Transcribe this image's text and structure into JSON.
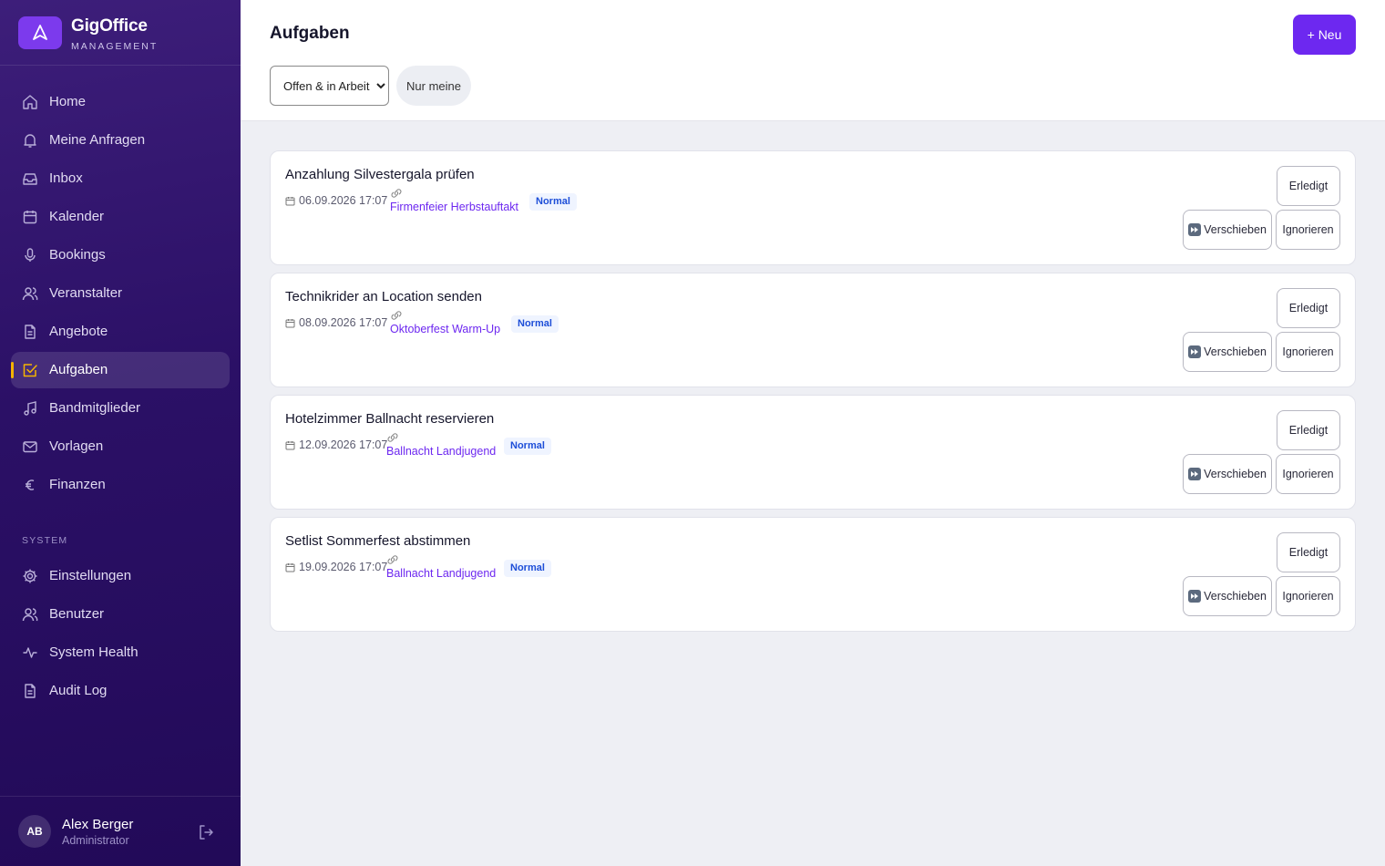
{
  "brand": {
    "name": "GigOffice",
    "subtitle": "MANAGEMENT"
  },
  "sidebar": {
    "items": [
      {
        "label": "Home",
        "icon": "home-icon"
      },
      {
        "label": "Meine Anfragen",
        "icon": "bell-icon"
      },
      {
        "label": "Inbox",
        "icon": "inbox-icon"
      },
      {
        "label": "Kalender",
        "icon": "calendar-icon"
      },
      {
        "label": "Bookings",
        "icon": "microphone-icon"
      },
      {
        "label": "Veranstalter",
        "icon": "users-icon"
      },
      {
        "label": "Angebote",
        "icon": "document-icon"
      },
      {
        "label": "Aufgaben",
        "icon": "checkbox-icon",
        "active": true
      },
      {
        "label": "Bandmitglieder",
        "icon": "music-icon"
      },
      {
        "label": "Vorlagen",
        "icon": "mail-icon"
      },
      {
        "label": "Finanzen",
        "icon": "euro-icon"
      }
    ],
    "system_label": "SYSTEM",
    "system_items": [
      {
        "label": "Einstellungen",
        "icon": "gear-icon"
      },
      {
        "label": "Benutzer",
        "icon": "users-icon"
      },
      {
        "label": "System Health",
        "icon": "activity-icon"
      },
      {
        "label": "Audit Log",
        "icon": "document-icon"
      }
    ],
    "active_indicator_color": "#f5b400"
  },
  "user": {
    "initials": "AB",
    "name": "Alex Berger",
    "role": "Administrator"
  },
  "header": {
    "title": "Aufgaben",
    "new_button": "+ Neu",
    "filter_selected": "Offen & in Arbeit",
    "mine_button": "Nur meine"
  },
  "actions": {
    "done": "Erledigt",
    "postpone": "Verschieben",
    "ignore": "Ignorieren"
  },
  "tasks": [
    {
      "title": "Anzahlung Silvestergala prüfen",
      "date": "06.09.2026 17:07",
      "link": "Firmenfeier Herbstauftakt",
      "priority": "Normal"
    },
    {
      "title": "Technikrider an Location senden",
      "date": "08.09.2026 17:07",
      "link": "Oktoberfest Warm-Up",
      "priority": "Normal"
    },
    {
      "title": "Hotelzimmer Ballnacht reservieren",
      "date": "12.09.2026 17:07",
      "link": "Ballnacht Landjugend",
      "priority": "Normal"
    },
    {
      "title": "Setlist Sommerfest abstimmen",
      "date": "19.09.2026 17:07",
      "link": "Ballnacht Landjugend",
      "priority": "Normal"
    }
  ],
  "colors": {
    "accent": "#6d28f0",
    "sidebar": "#2b1066",
    "badge_text": "#1d4ed8",
    "badge_bg": "#eff4ff"
  }
}
